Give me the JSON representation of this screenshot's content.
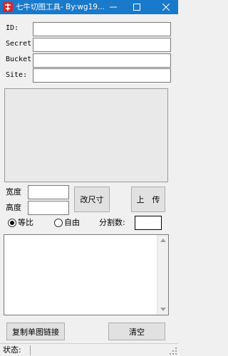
{
  "window": {
    "title": "七牛切图工具- By:wg19...",
    "icon": "app-logo-icon",
    "controls": [
      "minimize-icon",
      "maximize-icon",
      "close-icon"
    ]
  },
  "credentials": {
    "id_label": "ID:",
    "id_value": "",
    "secret_label": "Secret:",
    "secret_value": "",
    "bucket_label": "Bucket:",
    "bucket_value": "",
    "site_label": "Site:",
    "site_value": ""
  },
  "resize": {
    "width_label": "宽度",
    "width_value": "",
    "height_label": "高度",
    "height_value": "",
    "resize_button": "改尺寸",
    "upload_button": "上　传"
  },
  "mode": {
    "proportional_label": "等比",
    "proportional_selected": true,
    "free_label": "自由",
    "free_selected": false,
    "split_label": "分割数:",
    "split_value": ""
  },
  "log": {
    "content": ""
  },
  "actions": {
    "copy_button": "复制单图链接",
    "clear_button": "清空"
  },
  "status": {
    "label": "状态:",
    "text": ""
  },
  "colors": {
    "titlebar": "#1979ca",
    "icon_red": "#d9262b"
  }
}
